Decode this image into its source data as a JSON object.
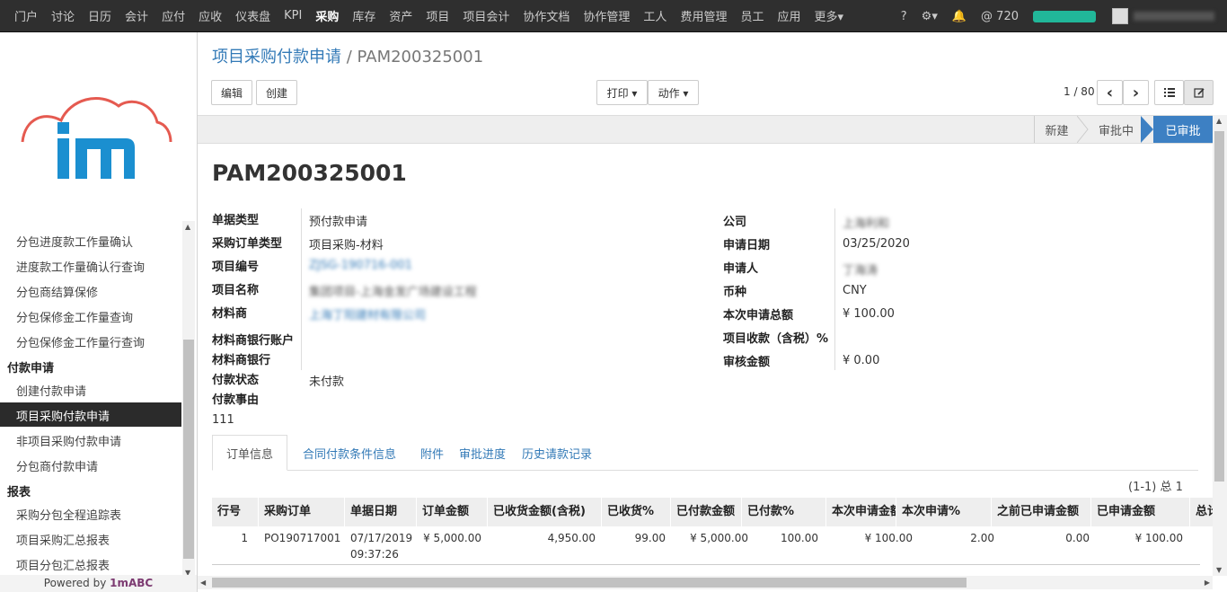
{
  "topbar": {
    "menu": [
      "门户",
      "讨论",
      "日历",
      "会计",
      "应付",
      "应收",
      "仪表盘",
      "KPI",
      "采购",
      "库存",
      "资产",
      "项目",
      "项目会计",
      "协作文档",
      "协作管理",
      "工人",
      "费用管理",
      "员工",
      "应用",
      "更多▾"
    ],
    "active": "采购",
    "help": "?",
    "settings": "⚙▾",
    "notifications": "🔔",
    "mentions": "@ 720",
    "progress_percent": 100
  },
  "sidebar": {
    "items": [
      {
        "label": "分包进度款工作量确认",
        "kind": "item"
      },
      {
        "label": "进度款工作量确认行查询",
        "kind": "item"
      },
      {
        "label": "分包商结算保修",
        "kind": "item"
      },
      {
        "label": "分包保修金工作量查询",
        "kind": "item"
      },
      {
        "label": "分包保修金工作量行查询",
        "kind": "item"
      },
      {
        "label": "付款申请",
        "kind": "cat"
      },
      {
        "label": "创建付款申请",
        "kind": "item"
      },
      {
        "label": "项目采购付款申请",
        "kind": "sel"
      },
      {
        "label": "非项目采购付款申请",
        "kind": "item"
      },
      {
        "label": "分包商付款申请",
        "kind": "item"
      },
      {
        "label": "报表",
        "kind": "cat"
      },
      {
        "label": "采购分包全程追踪表",
        "kind": "item"
      },
      {
        "label": "项目采购汇总报表",
        "kind": "item"
      },
      {
        "label": "项目分包汇总报表",
        "kind": "item"
      }
    ],
    "powered_prefix": "Powered by ",
    "powered_brand": "1mABC"
  },
  "breadcrumb": {
    "parent": "项目采购付款申请",
    "sep": "/",
    "current": "PAM200325001"
  },
  "toolbar": {
    "edit": "编辑",
    "create": "创建",
    "print": "打印 ▾",
    "action": "动作 ▾",
    "pager": "1 / 80",
    "prev": "‹",
    "next": "›"
  },
  "stages": {
    "new": "新建",
    "approving": "审批中",
    "approved": "已审批"
  },
  "form": {
    "title": "PAM200325001",
    "left": [
      {
        "label": "单据类型",
        "value": "预付款申请"
      },
      {
        "label": "采购订单类型",
        "value": "项目采购-材料"
      },
      {
        "label": "项目编号",
        "value": "ZJSG-190716-001"
      },
      {
        "label": "项目名称",
        "value": "集团项目-上海金发广场建设工程"
      },
      {
        "label": "材料商",
        "value": "上海丁阳建材有限公司"
      },
      {
        "label": "材料商银行账户",
        "value": ""
      },
      {
        "label": "材料商银行",
        "value": ""
      },
      {
        "label": "付款状态",
        "value": "未付款"
      },
      {
        "label": "付款事由",
        "value": ""
      }
    ],
    "reason_text": "111",
    "right": [
      {
        "label": "公司",
        "value": "上海利和"
      },
      {
        "label": "申请日期",
        "value": "03/25/2020"
      },
      {
        "label": "申请人",
        "value": "丁海涛"
      },
      {
        "label": "币种",
        "value": "CNY"
      },
      {
        "label": "本次申请总额",
        "value": "¥ 100.00"
      },
      {
        "label": "项目收款（含税）%",
        "value": ""
      },
      {
        "label": "审核金额",
        "value": "¥ 0.00"
      }
    ]
  },
  "tabs": [
    "订单信息",
    "合同付款条件信息",
    "附件",
    "审批进度",
    "历史请款记录"
  ],
  "table": {
    "count": "(1-1) 总 1",
    "headers": [
      "行号",
      "采购订单",
      "单据日期",
      "订单金额",
      "已收货金额(含税)",
      "已收货%",
      "已付款金额",
      "已付款%",
      "本次申请金额",
      "本次申请%",
      "之前已申请金额",
      "已申请金额",
      "总计"
    ],
    "row": [
      "1",
      "PO190717001",
      "07/17/2019",
      "09:37:26",
      "¥ 5,000.00",
      "4,950.00",
      "99.00",
      "¥ 5,000.00",
      "100.00",
      "¥ 100.00",
      "2.00",
      "0.00",
      "¥ 100.00"
    ]
  }
}
